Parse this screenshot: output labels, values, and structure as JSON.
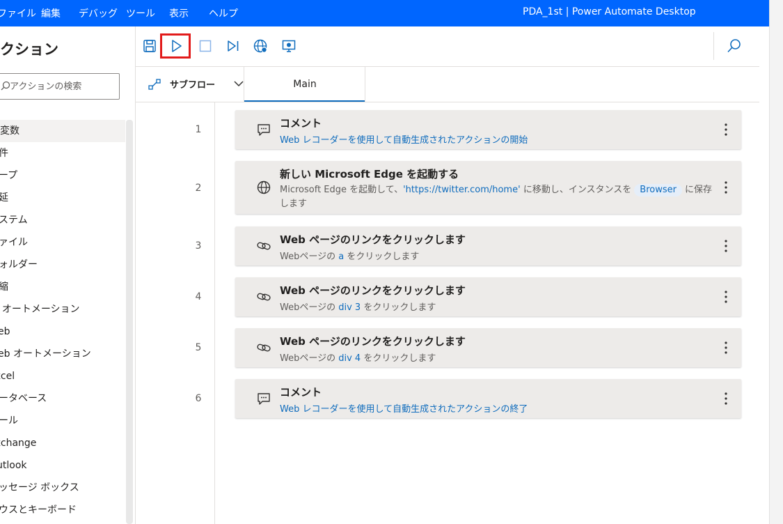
{
  "menubar": {
    "items": [
      "ファイル",
      "編集",
      "デバッグ",
      "ツール",
      "表示",
      "ヘルプ"
    ],
    "title": "PDA_1st | Power Automate Desktop",
    "background": "#0066ff"
  },
  "actions_panel": {
    "title": "アクション",
    "search_placeholder": "アクションの検索",
    "categories": [
      "変数",
      "条件",
      "ループ",
      "遅延",
      "システム",
      "ファイル",
      "フォルダー",
      "圧縮",
      "UI オートメーション",
      "Web",
      "Web オートメーション",
      "Excel",
      "データベース",
      "メール",
      "Exchange",
      "Outlook",
      "メッセージ ボックス",
      "マウスとキーボード"
    ]
  },
  "toolbar": {
    "buttons": [
      {
        "name": "save",
        "icon": "save-icon"
      },
      {
        "name": "run",
        "icon": "play-icon"
      },
      {
        "name": "stop",
        "icon": "stop-icon"
      },
      {
        "name": "run-next",
        "icon": "step-icon"
      },
      {
        "name": "web-recorder",
        "icon": "globe-record-icon"
      },
      {
        "name": "desktop-recorder",
        "icon": "desktop-record-icon"
      }
    ],
    "highlight_color": "#e21b1b",
    "search_icon": "search-icon"
  },
  "tabbar": {
    "subflow_label": "サブフロー",
    "main_tab": "Main"
  },
  "flow": {
    "steps": [
      {
        "no": "1",
        "icon": "comment-icon",
        "title": "コメント",
        "desc": "Web レコーダーを使用して自動生成されたアクションの開始"
      },
      {
        "no": "2",
        "icon": "globe-icon",
        "title": "新しい Microsoft Edge を起動する",
        "desc_a": "Microsoft Edge を起動して、",
        "desc_url": "'https://twitter.com/home'",
        "desc_b": "に移動し、インスタンスを",
        "desc_var": "Browser",
        "desc_c": "に保存",
        "desc_d": "します"
      },
      {
        "no": "3",
        "icon": "link-icon",
        "title": "Web ページのリンクをクリックします",
        "desc_a": "Webページの",
        "desc_el": "a",
        "desc_b": "をクリックします"
      },
      {
        "no": "4",
        "icon": "link-icon",
        "title": "Web ページのリンクをクリックします",
        "desc_a": "Webページの",
        "desc_el": "div 3",
        "desc_b": "をクリックします"
      },
      {
        "no": "5",
        "icon": "link-icon",
        "title": "Web ページのリンクをクリックします",
        "desc_a": "Webページの",
        "desc_el": "div 4",
        "desc_b": "をクリックします"
      },
      {
        "no": "6",
        "icon": "comment-icon",
        "title": "コメント",
        "desc": "Web レコーダーを使用して自動生成されたアクションの終了"
      }
    ]
  }
}
